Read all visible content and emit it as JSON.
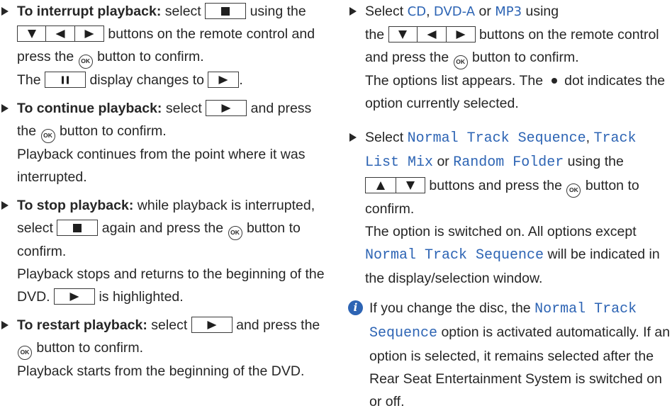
{
  "left": {
    "interrupt": {
      "heading": "To interrupt playback:",
      "t1": "select",
      "t2": "using",
      "t3": "the",
      "t4": "buttons on the remote",
      "t5": "control and press the",
      "ok": "OK",
      "t6": "button to confirm.",
      "t7": "The",
      "t8": "display changes to",
      "t9": "."
    },
    "continue": {
      "heading": "To continue playback:",
      "t1": "select",
      "t2": "and",
      "t3": "press the",
      "t4": "button to confirm.",
      "result": "Playback continues from the point where it was interrupted."
    },
    "stop": {
      "heading": "To stop playback:",
      "t1": "while playback is interrupted, select",
      "t2": "again and press the",
      "t3": "button to confirm.",
      "result1": "Playback stops and returns to the beginning of the DVD.",
      "result2": "is highlighted."
    },
    "restart": {
      "heading": "To restart playback:",
      "t1": "select",
      "t2": "and",
      "t3": "press the",
      "t4": "button to confirm.",
      "result": "Playback starts from the beginning of the DVD."
    }
  },
  "right": {
    "select_media": {
      "t1": "Select",
      "cd": "CD",
      "sep1": ",",
      "dvda": "DVD-A",
      "or": "or",
      "mp3": "MP3",
      "t2": "using",
      "t3": "the",
      "t4": "buttons on the remote",
      "t5": "control and press the",
      "t6": "button to confirm.",
      "result1": "The options list appears. The",
      "result2": "dot indicates the option currently selected."
    },
    "select_option": {
      "t1": "Select",
      "opt1": "Normal Track Sequence",
      "sep1": ",",
      "opt2": "Track List Mix",
      "or": "or",
      "opt3": "Random Folder",
      "t2": "using the",
      "t3": "buttons and press the",
      "t4": "button to confirm.",
      "result1": "The option is switched on. All options except",
      "result_opt": "Normal Track Sequence",
      "result2": "will be indicated in the display/selection window."
    },
    "note": {
      "t1": "If you change the disc, the",
      "opt": "Normal Track Sequence",
      "t2": "option is activated automatically. If an option is selected, it remains selected after the Rear Seat Entertainment System is switched on or off."
    }
  },
  "icons": {
    "stop": "stop-icon",
    "pause": "pause-icon",
    "play": "play-icon",
    "left": "left-arrow-icon",
    "down": "down-arrow-icon",
    "up": "up-arrow-icon",
    "ok": "ok-button-icon",
    "info": "info-icon",
    "dot": "dot-icon"
  },
  "colors": {
    "text": "#262626",
    "highlight": "#2d64b4",
    "info_badge": "#2d64b4"
  }
}
